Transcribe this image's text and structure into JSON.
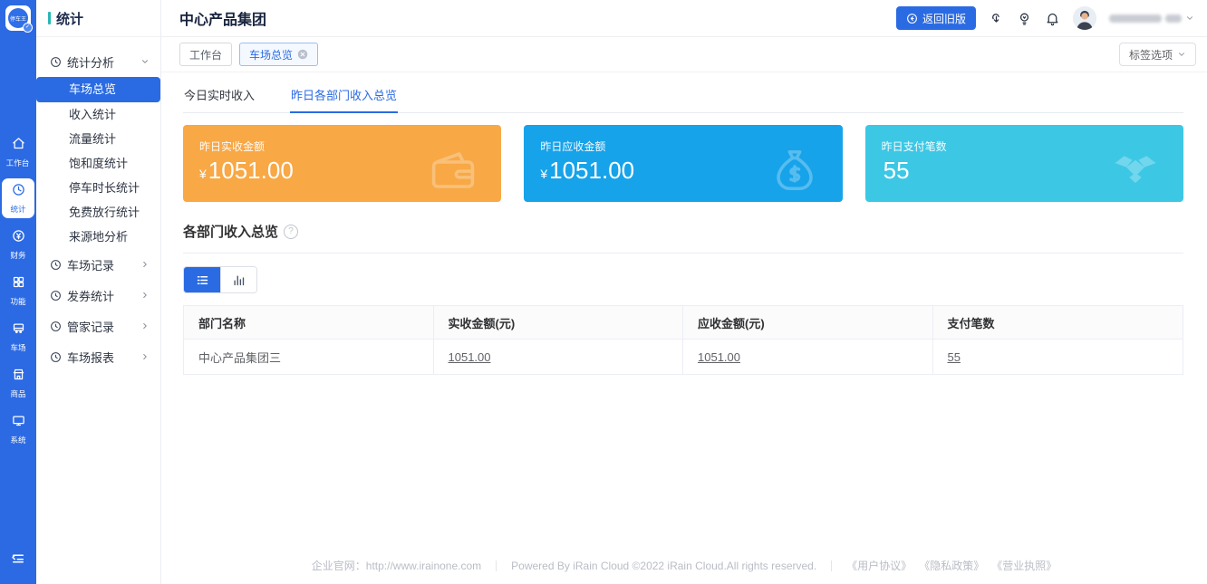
{
  "accent_color": "#2a6be3",
  "rail": {
    "logo_text": "停车王",
    "items": [
      {
        "label": "工作台",
        "icon": "home-icon",
        "active": false
      },
      {
        "label": "统计",
        "icon": "stats-icon",
        "active": true
      },
      {
        "label": "财务",
        "icon": "finance-icon",
        "active": false
      },
      {
        "label": "功能",
        "icon": "modules-icon",
        "active": false
      },
      {
        "label": "车场",
        "icon": "parking-icon",
        "active": false
      },
      {
        "label": "商品",
        "icon": "goods-icon",
        "active": false
      },
      {
        "label": "系统",
        "icon": "system-icon",
        "active": false
      }
    ]
  },
  "sidebar": {
    "title": "统计",
    "groups": [
      {
        "label": "统计分析",
        "expanded": true,
        "children": [
          "车场总览",
          "收入统计",
          "流量统计",
          "饱和度统计",
          "停车时长统计",
          "免费放行统计",
          "来源地分析"
        ],
        "active_child": "车场总览"
      },
      {
        "label": "车场记录",
        "expanded": false
      },
      {
        "label": "发券统计",
        "expanded": false
      },
      {
        "label": "管家记录",
        "expanded": false
      },
      {
        "label": "车场报表",
        "expanded": false
      }
    ]
  },
  "header": {
    "title": "中心产品集团",
    "back_label": "返回旧版",
    "icon_names": [
      "download-icon",
      "bulb-icon",
      "bell-icon"
    ]
  },
  "tagbar": {
    "tags": [
      {
        "label": "工作台",
        "closable": false,
        "active": false
      },
      {
        "label": "车场总览",
        "closable": true,
        "active": true
      }
    ],
    "options_label": "标签选项"
  },
  "tabs": [
    {
      "label": "今日实时收入",
      "active": false
    },
    {
      "label": "昨日各部门收入总览",
      "active": true
    }
  ],
  "cards": [
    {
      "label": "昨日实收金额",
      "prefix": "¥",
      "value": "1051.00",
      "color": "#f8a845",
      "icon": "wallet-icon"
    },
    {
      "label": "昨日应收金额",
      "prefix": "¥",
      "value": "1051.00",
      "color": "#16a3ea",
      "icon": "moneybag-icon"
    },
    {
      "label": "昨日支付笔数",
      "prefix": "",
      "value": "55",
      "color": "#3cc7e5",
      "icon": "handshake-icon"
    }
  ],
  "section": {
    "title": "各部门收入总览"
  },
  "table": {
    "headers": [
      "部门名称",
      "实收金额(元)",
      "应收金额(元)",
      "支付笔数"
    ],
    "rows": [
      [
        "中心产品集团三",
        "1051.00",
        "1051.00",
        "55"
      ]
    ]
  },
  "footer": {
    "site": "企业官网：http://www.irainone.com",
    "copyright": "Powered By iRain Cloud ©2022 iRain Cloud.All rights reserved.",
    "links": [
      "《用户协议》",
      "《隐私政策》",
      "《营业执照》"
    ]
  }
}
